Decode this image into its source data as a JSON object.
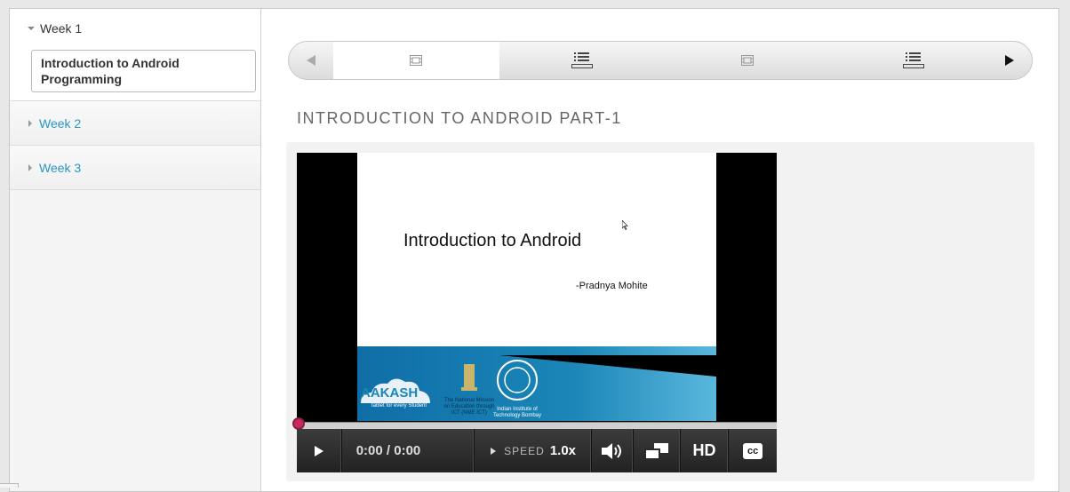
{
  "sidebar": {
    "weeks": [
      {
        "label": "Week 1",
        "expanded": true,
        "lessons": [
          {
            "label": "Introduction to Android Programming"
          }
        ]
      },
      {
        "label": "Week 2",
        "expanded": false
      },
      {
        "label": "Week 3",
        "expanded": false
      }
    ]
  },
  "sequence_nav": {
    "items": [
      {
        "icon": "video-icon",
        "active": true
      },
      {
        "icon": "list-icon",
        "active": false
      },
      {
        "icon": "video-icon",
        "active": false
      },
      {
        "icon": "list-icon",
        "active": false
      }
    ]
  },
  "page": {
    "title": "INTRODUCTION TO ANDROID PART-1"
  },
  "video": {
    "slide_title": "Introduction to Android",
    "slide_author": "-Pradnya Mohite",
    "logos": {
      "aakash": "AAKASH",
      "aakash_tagline": "tablet for every Student",
      "mission": "The National Mission on Education through ICT (NME ICT)",
      "iit": "Indian Institute of Technology Bombay"
    },
    "progress": 0,
    "time": "0:00 / 0:00",
    "speed_label": "SPEED",
    "speed_value": "1.0x",
    "hd_label": "HD",
    "cc_label": "cc"
  },
  "colors": {
    "accent_link": "#2a94c2",
    "progress_handle": "#c8285d",
    "slide_band": "#1b86b8"
  }
}
